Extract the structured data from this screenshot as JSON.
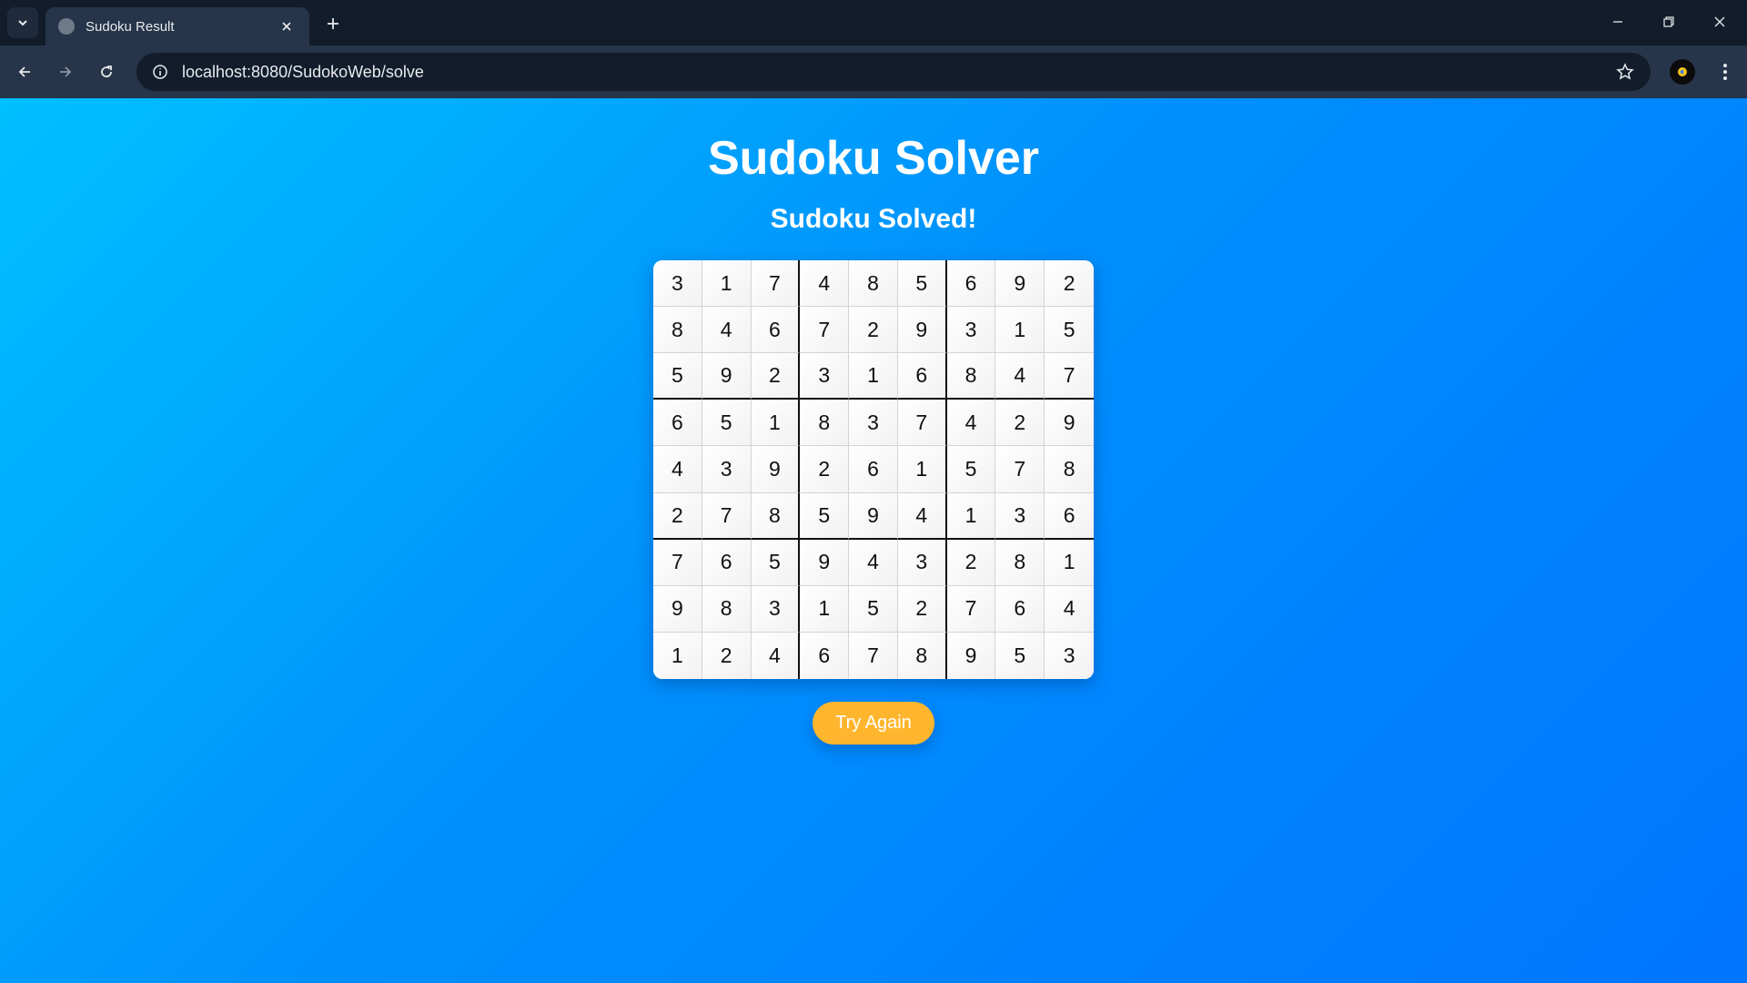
{
  "browser": {
    "tab_title": "Sudoku Result",
    "url": "localhost:8080/SudokoWeb/solve"
  },
  "icons": {
    "tab_menu": "chevron-down-icon",
    "favicon": "globe-icon",
    "tab_close": "close-icon",
    "new_tab": "plus-icon",
    "minimize": "minimize-icon",
    "restore": "restore-icon",
    "close_window": "close-icon",
    "back": "arrow-left-icon",
    "forward": "arrow-right-icon",
    "reload": "reload-icon",
    "site_info": "info-icon",
    "bookmark": "star-icon",
    "profile": "avatar-icon",
    "menu": "kebab-menu-icon"
  },
  "page": {
    "title": "Sudoku Solver",
    "status": "Sudoku Solved!",
    "button_label": "Try Again"
  },
  "colors": {
    "background_start": "#00c0ff",
    "background_end": "#0075ff",
    "button": "#ffb62e"
  },
  "grid": [
    [
      3,
      1,
      7,
      4,
      8,
      5,
      6,
      9,
      2
    ],
    [
      8,
      4,
      6,
      7,
      2,
      9,
      3,
      1,
      5
    ],
    [
      5,
      9,
      2,
      3,
      1,
      6,
      8,
      4,
      7
    ],
    [
      6,
      5,
      1,
      8,
      3,
      7,
      4,
      2,
      9
    ],
    [
      4,
      3,
      9,
      2,
      6,
      1,
      5,
      7,
      8
    ],
    [
      2,
      7,
      8,
      5,
      9,
      4,
      1,
      3,
      6
    ],
    [
      7,
      6,
      5,
      9,
      4,
      3,
      2,
      8,
      1
    ],
    [
      9,
      8,
      3,
      1,
      5,
      2,
      7,
      6,
      4
    ],
    [
      1,
      2,
      4,
      6,
      7,
      8,
      9,
      5,
      3
    ]
  ]
}
